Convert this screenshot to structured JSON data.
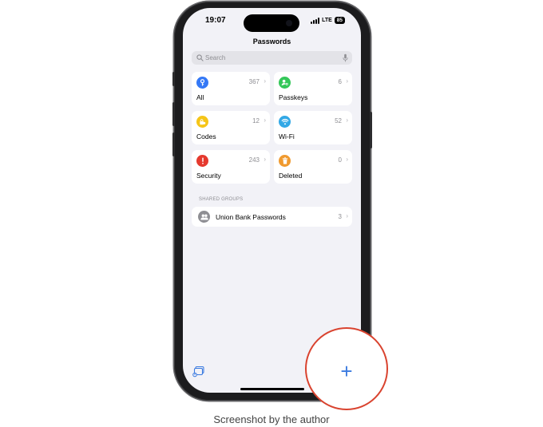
{
  "status_bar": {
    "time": "19:07",
    "network": "LTE",
    "battery": "85"
  },
  "header": {
    "title": "Passwords"
  },
  "search": {
    "placeholder": "Search"
  },
  "categories": [
    {
      "label": "All",
      "count": "367",
      "icon": "key-icon",
      "color": "#3478f6"
    },
    {
      "label": "Passkeys",
      "count": "6",
      "icon": "person-key-icon",
      "color": "#34c759"
    },
    {
      "label": "Codes",
      "count": "12",
      "icon": "lock-clock-icon",
      "color": "#f5c518"
    },
    {
      "label": "Wi-Fi",
      "count": "52",
      "icon": "wifi-icon",
      "color": "#32a8e6"
    },
    {
      "label": "Security",
      "count": "243",
      "icon": "exclamation-icon",
      "color": "#e5392e"
    },
    {
      "label": "Deleted",
      "count": "0",
      "icon": "trash-icon",
      "color": "#f09a2f"
    }
  ],
  "shared_groups": {
    "header": "SHARED GROUPS",
    "items": [
      {
        "label": "Union Bank Passwords",
        "count": "3",
        "icon": "people-icon"
      }
    ]
  },
  "toolbar": {
    "add_label": "+",
    "accent": "#3b7be0",
    "highlight_color": "#d9432f"
  },
  "caption": "Screenshot by the author"
}
